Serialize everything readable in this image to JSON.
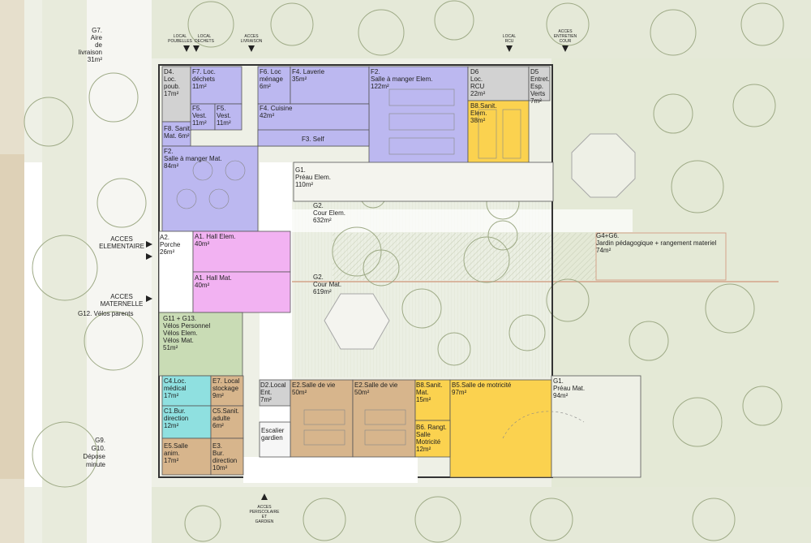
{
  "rooms": {
    "d4": [
      "D4.",
      "Loc.",
      "poub.",
      "17m²"
    ],
    "f7": [
      "F7. Loc.",
      "déchets",
      "11m²"
    ],
    "f6": [
      "F6. Loc",
      "ménage",
      "6m²"
    ],
    "f4_laverie": [
      "F4. Laverie",
      "35m²"
    ],
    "f2_elem": [
      "F2.",
      "Salle à manger Elem.",
      "122m²"
    ],
    "d6": [
      "D6",
      "Loc.",
      "RCU",
      "22m²"
    ],
    "d5": [
      "D5",
      "Entret.",
      "Esp.",
      "Verts",
      "7m²"
    ],
    "f5a": [
      "F5.",
      "Vest.",
      "11m²"
    ],
    "f5b": [
      "F5.",
      "Vest.",
      "11m²"
    ],
    "f4_cuisine": [
      "F4. Cuisine",
      "42m²"
    ],
    "b8_elem": [
      "B8.Sanit.",
      "Elem.",
      "38m²"
    ],
    "f8": [
      "F8. Sanit.",
      "Mat. 6m²"
    ],
    "f3": [
      "F3. Self"
    ],
    "f2_mat": [
      "F2.",
      "Salle à manger Mat.",
      "84m²"
    ],
    "g1_elem": [
      "G1.",
      "Préau Elem.",
      "110m²"
    ],
    "g2_elem": [
      "G2.",
      "Cour Elem.",
      "632m²"
    ],
    "a2": [
      "A2.",
      "Porche",
      "26m²"
    ],
    "a1_elem": [
      "A1. Hall Elem.",
      "40m²"
    ],
    "a1_mat": [
      "A1. Hall Mat.",
      "40m²"
    ],
    "g2_mat": [
      "G2.",
      "Cour Mat.",
      "619m²"
    ],
    "g4g6": [
      "G4+G6.",
      "Jardin pédagogique + rangement materiel",
      "74m²"
    ],
    "g11": [
      "G11 + G13.",
      "Vélos Personnel",
      "Vélos Elem.",
      "Vélos Mat.",
      "51m²"
    ],
    "c4": [
      "C4.Loc.",
      "médical",
      "17m²"
    ],
    "e7": [
      "E7. Local",
      "stockage",
      "9m²"
    ],
    "d2": [
      "D2.Local",
      "Ent.",
      "7m²"
    ],
    "e2a": [
      "E2.Salle de vie",
      "50m²"
    ],
    "e2b": [
      "E2.Salle de vie",
      "50m²"
    ],
    "b8_mat": [
      "B8.Sanit.",
      "Mat.",
      "15m²"
    ],
    "b5": [
      "B5.Salle de motricité",
      "97m²"
    ],
    "g1_mat": [
      "G1.",
      "Préau Mat.",
      "94m²"
    ],
    "c1": [
      "C1.Bur.",
      "direction",
      "12m²"
    ],
    "c5": [
      "C5.Sanit.",
      "adulte",
      "6m²"
    ],
    "escalier": [
      "Escalier",
      "gardien"
    ],
    "b6": [
      "B6. Rangt.",
      "Salle",
      "Motricité",
      "12m²"
    ],
    "e5": [
      "E5.Salle",
      "anim.",
      "17m²"
    ],
    "e3": [
      "E3.",
      "Bur.",
      "direction",
      "10m²"
    ]
  },
  "outside": {
    "g7": [
      "G7.",
      "Aire",
      "de",
      "livraison",
      "31m²"
    ],
    "g9": [
      "G9.",
      "G10.",
      "Dépose",
      "minute"
    ],
    "g12": "G12. Vélos parents"
  },
  "accesses": {
    "elementaire": [
      "ACCES",
      "ELEMENTAIRE"
    ],
    "maternelle": [
      "ACCES",
      "MATERNELLE"
    ],
    "local_poubelles": [
      "LOCAL",
      "POUBELLES"
    ],
    "local_dechets": [
      "LOCAL",
      "DECHETS"
    ],
    "acces_livraison": [
      "ACCES",
      "LIVRAISON"
    ],
    "local_rcu": [
      "LOCAL",
      "RCU"
    ],
    "acces_entretien": [
      "ACCES",
      "ENTRETIEN",
      "COUR"
    ],
    "acces_periscolaire": [
      "ACCES",
      "PERISCOLAIRE",
      "ET",
      "GARDIEN"
    ]
  },
  "colors": {
    "blue_program": "#bcb8f0",
    "pink_hall": "#f2b2f2",
    "green_bikes": "#c9dcb5",
    "cyan_admin": "#8fe0e0",
    "tan_classes": "#d7b58c",
    "yellow_motricite": "#fbd24f",
    "grey_technical": "#d2d2d2",
    "courtyard": "#e6ecd9"
  }
}
